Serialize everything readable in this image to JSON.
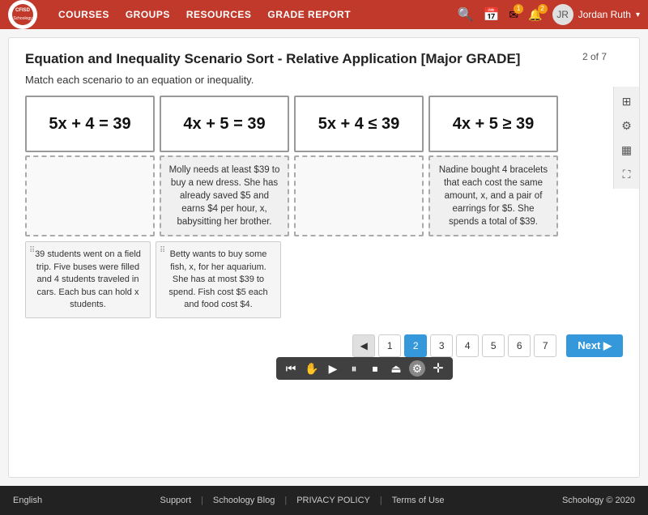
{
  "nav": {
    "logo_text_line1": "CFISD",
    "logo_text_line2": "Schoology",
    "links": [
      "COURSES",
      "GROUPS",
      "RESOURCES",
      "GRADE REPORT"
    ],
    "user_name": "Jordan Ruth",
    "notification_count": "1",
    "message_count": "2"
  },
  "page": {
    "counter": "2 of 7",
    "title": "Equation and Inequality Scenario Sort - Relative Application [Major GRADE]",
    "instruction": "Match each scenario to an equation or inequality.",
    "equations": [
      "5x + 4 = 39",
      "4x + 5 = 39",
      "5x + 4 ≤ 39",
      "4x + 5 ≥ 39"
    ],
    "placed_cards": [
      "",
      "Molly needs at least $39 to buy a new dress. She has already saved $5 and earns $4 per hour, x, babysitting her brother.",
      "",
      "Nadine bought 4 bracelets that each cost the same amount, x, and a pair of earrings for $5. She spends a total of $39."
    ],
    "scenario_cards": [
      "39 students went on a field trip. Five buses were filled and 4 students traveled in cars. Each bus can hold x students.",
      "Betty wants to buy some fish, x, for her aquarium. She has at most $39 to spend. Fish cost $5 each and food cost $4."
    ]
  },
  "pagination": {
    "pages": [
      "1",
      "2",
      "3",
      "4",
      "5",
      "6",
      "7"
    ],
    "current": "2",
    "prev_label": "◀",
    "next_label": "Next ▶"
  },
  "footer": {
    "language": "English",
    "links": [
      "Support",
      "Schoology Blog",
      "PRIVACY POLICY",
      "Terms of Use"
    ],
    "copyright": "Schoology © 2020"
  },
  "sidebar_icons": [
    "📅",
    "⚙",
    "🖩",
    "⛶"
  ],
  "media_toolbar": {
    "buttons": [
      "▶▐",
      "▶",
      "⏸",
      "⏹",
      "⏏",
      "⚙",
      "✛"
    ]
  }
}
